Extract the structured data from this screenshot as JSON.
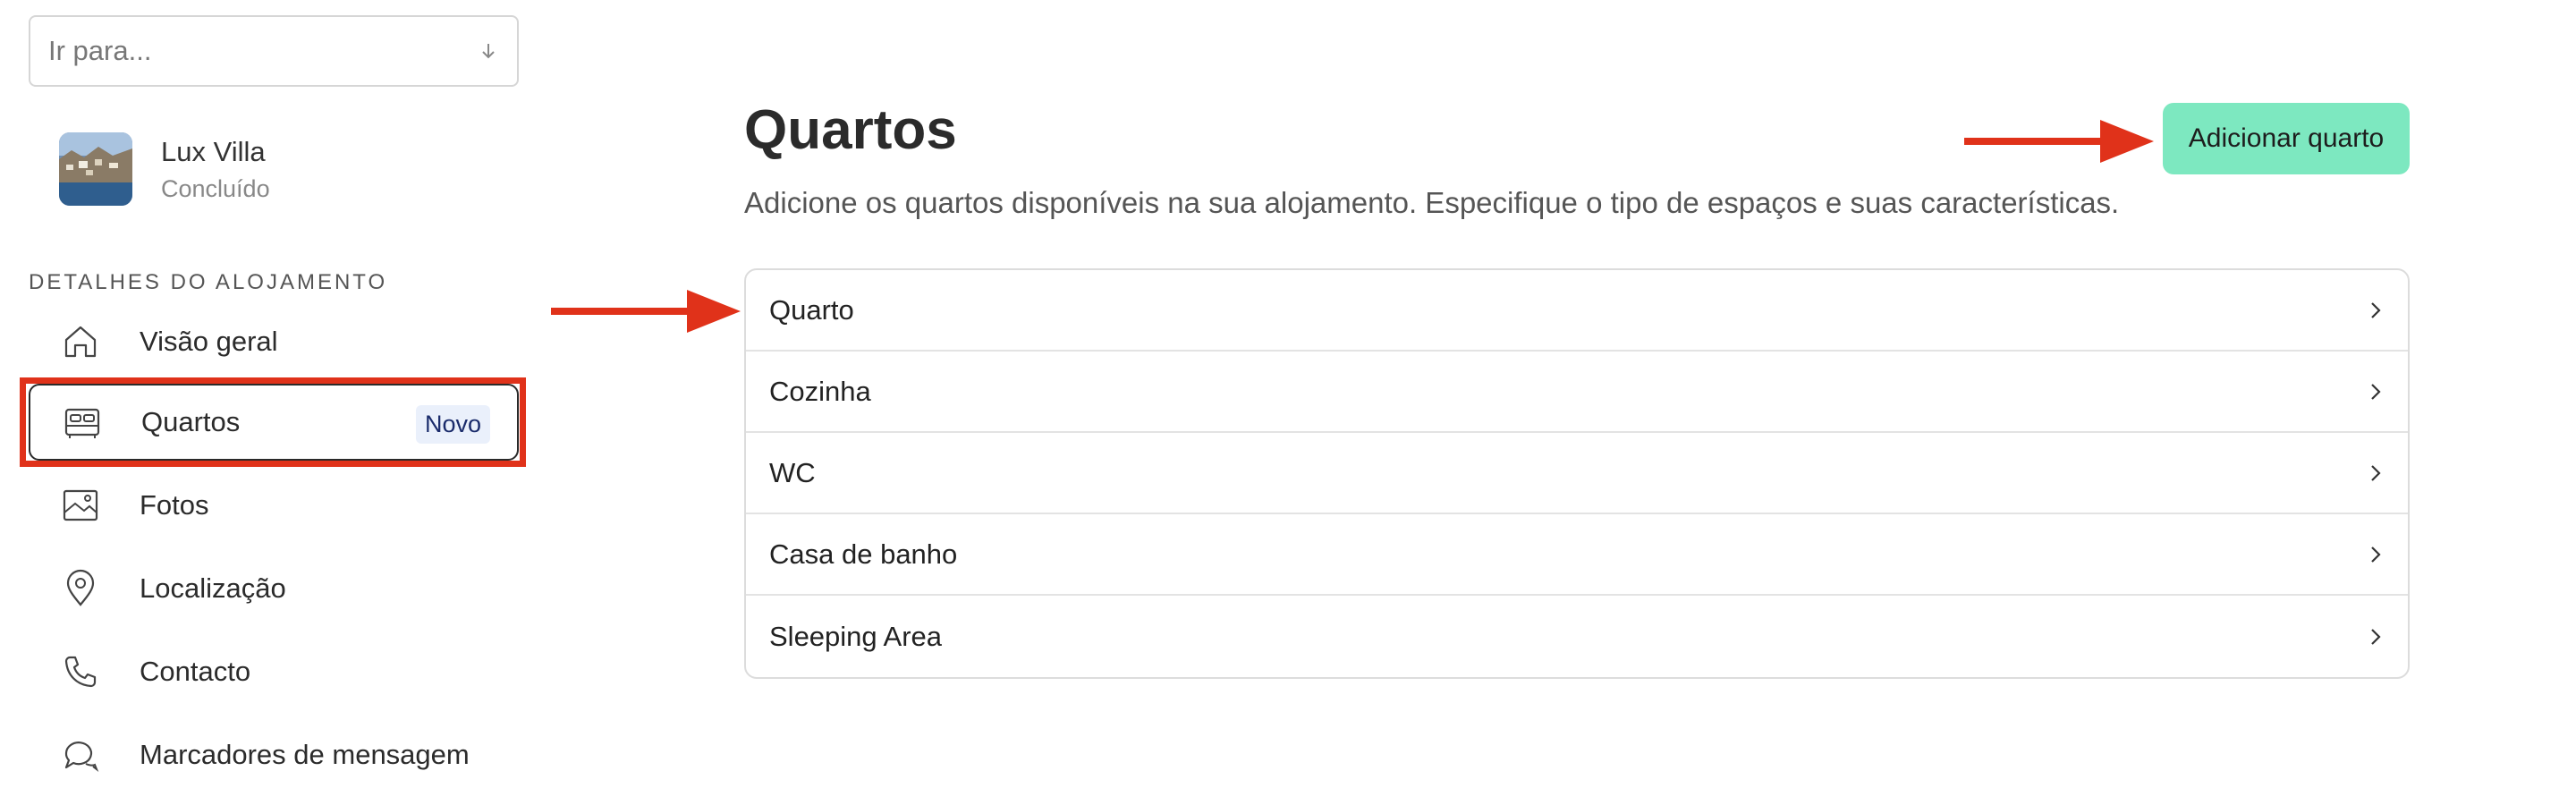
{
  "sidebar": {
    "goto_placeholder": "Ir para...",
    "property": {
      "name": "Lux Villa",
      "status": "Concluído"
    },
    "section_label": "DETALHES DO ALOJAMENTO",
    "items": [
      {
        "label": "Visão geral",
        "icon": "home-icon"
      },
      {
        "label": "Quartos",
        "icon": "bed-icon",
        "badge": "Novo",
        "active": true
      },
      {
        "label": "Fotos",
        "icon": "image-icon"
      },
      {
        "label": "Localização",
        "icon": "location-pin-icon"
      },
      {
        "label": "Contacto",
        "icon": "phone-icon"
      },
      {
        "label": "Marcadores de mensagem",
        "icon": "chat-bubbles-icon"
      }
    ]
  },
  "main": {
    "title": "Quartos",
    "subtitle": "Adicione os quartos disponíveis na sua alojamento. Especifique o tipo de espaços e suas características.",
    "add_button_label": "Adicionar quarto",
    "rooms": [
      "Quarto",
      "Cozinha",
      "WC",
      "Casa de banho",
      "Sleeping Area"
    ]
  },
  "colors": {
    "accent_button": "#7de8c0",
    "annotation_red": "#e0321a",
    "badge_bg": "#eaf0fb"
  }
}
